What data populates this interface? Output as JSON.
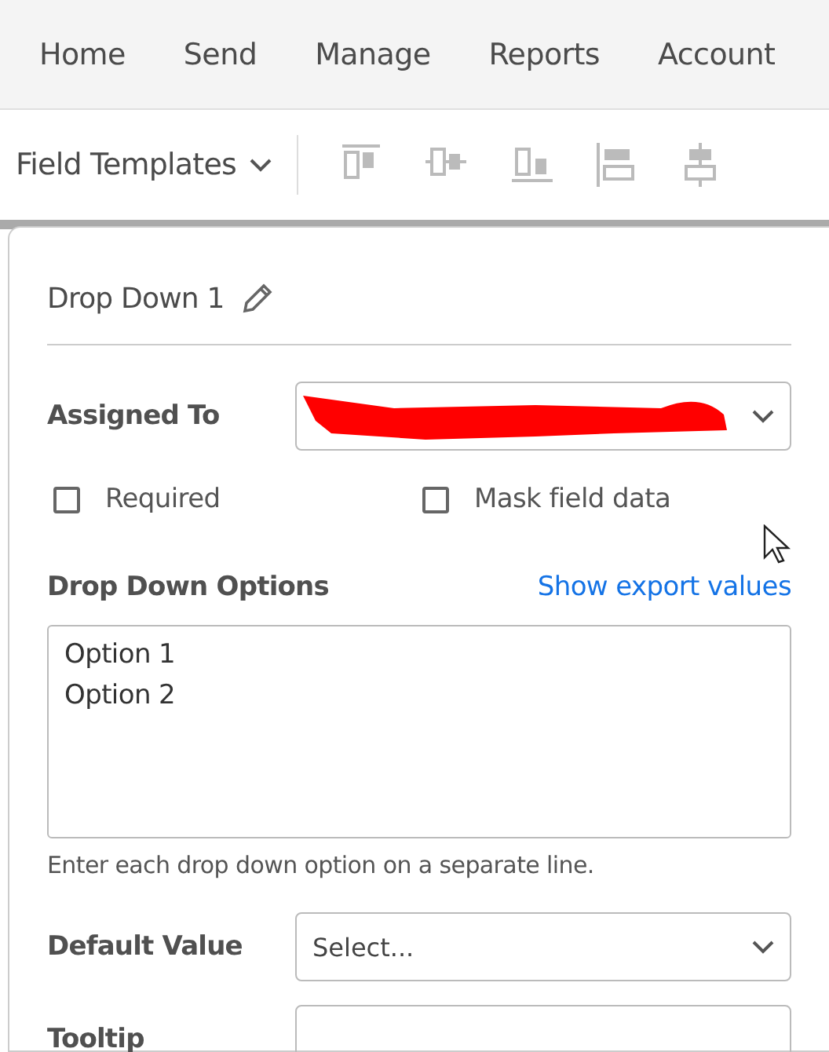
{
  "nav": {
    "items": [
      {
        "label": "Home",
        "selected": false
      },
      {
        "label": "Send",
        "selected": false
      },
      {
        "label": "Manage",
        "selected": false
      },
      {
        "label": "Reports",
        "selected": false
      },
      {
        "label": "Account",
        "selected": false
      }
    ]
  },
  "toolbar": {
    "templates": "Field Templates",
    "tools": [
      {
        "kind": "align-top"
      },
      {
        "kind": "align-middle"
      },
      {
        "kind": "align-bottom"
      },
      {
        "kind": "align-left"
      },
      {
        "kind": "align-center"
      }
    ]
  },
  "panel": {
    "title": "Drop Down 1",
    "assigned_to": {
      "label": "Assigned To",
      "redacted": true
    },
    "checkboxes": [
      {
        "label": "Required",
        "checked": false
      },
      {
        "label": "Mask field data",
        "checked": false
      }
    ],
    "options": {
      "label": "Drop Down Options",
      "link": "Show export values",
      "lines": [
        "Option 1",
        "Option 2"
      ],
      "hint": "Enter each drop down option on a separate line."
    },
    "default_value": {
      "label": "Default Value",
      "placeholder": "Select..."
    },
    "tooltip": {
      "label": "Tooltip"
    }
  }
}
